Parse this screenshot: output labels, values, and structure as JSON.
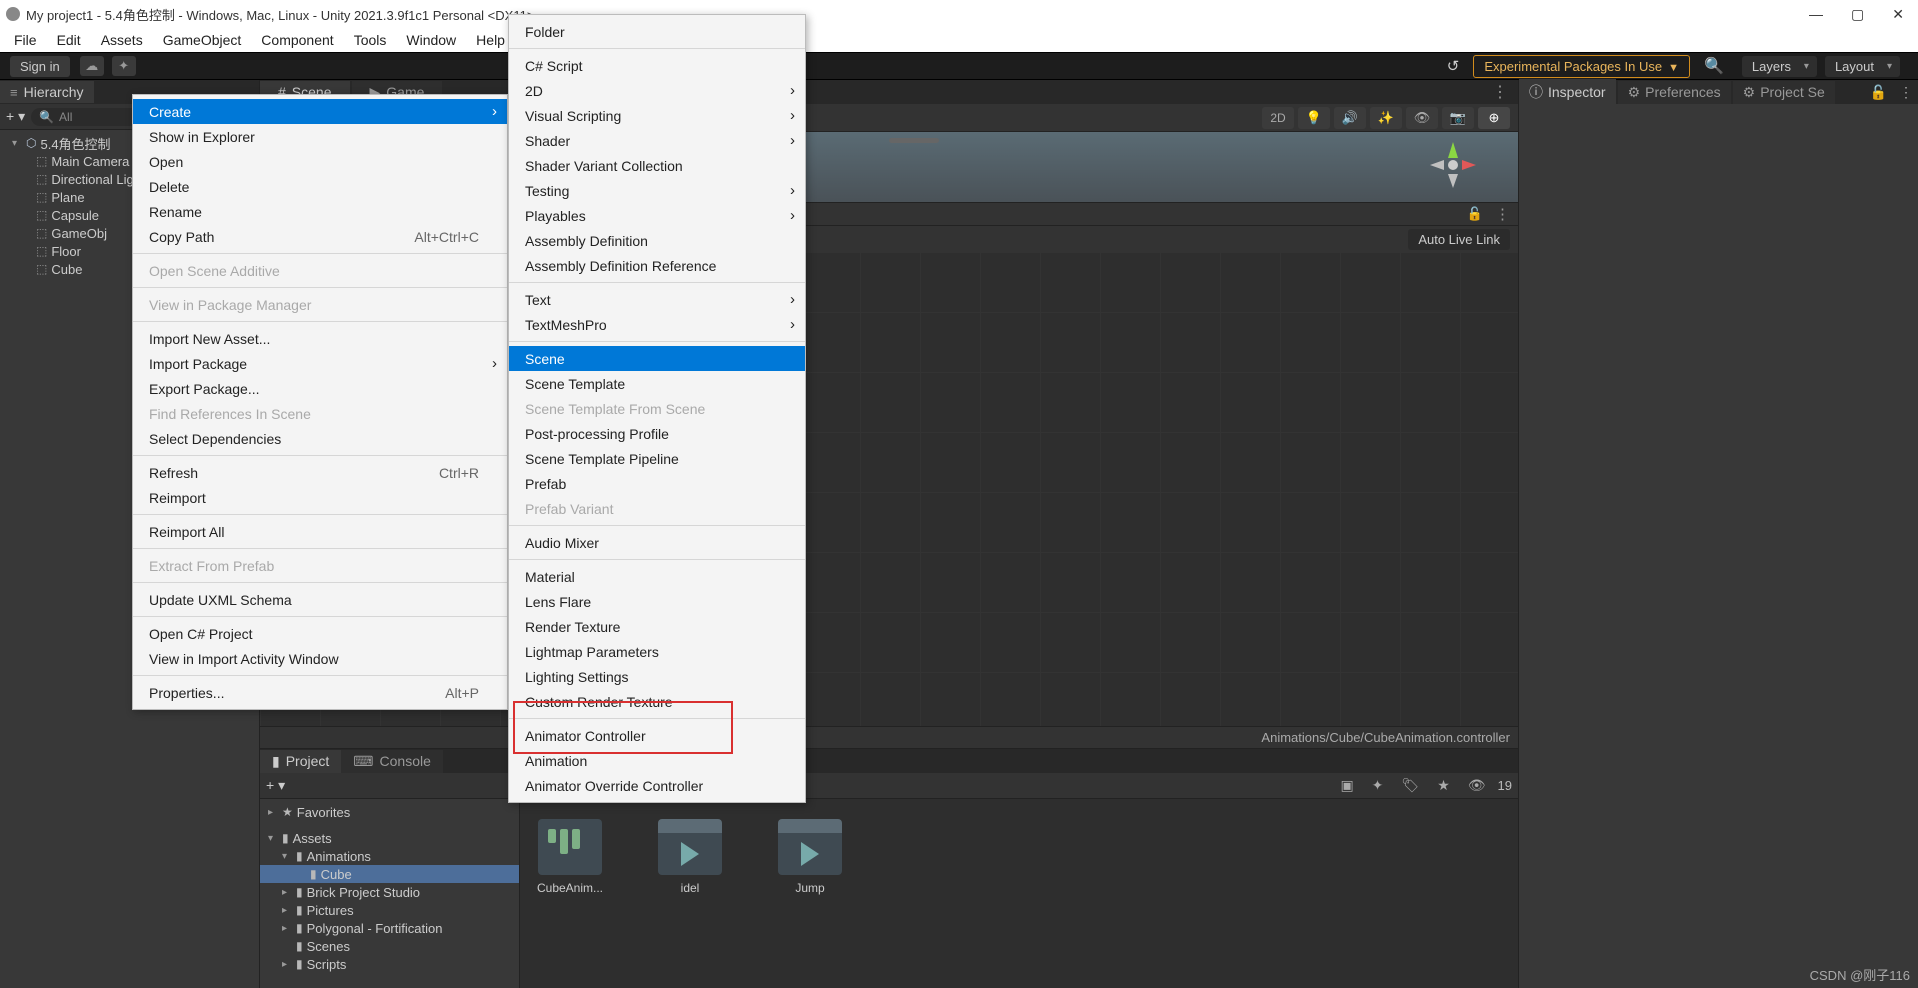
{
  "titlebar": {
    "title": "My project1 - 5.4角色控制 - Windows, Mac, Linux - Unity 2021.3.9f1c1 Personal <DX11>"
  },
  "menubar": [
    "File",
    "Edit",
    "Assets",
    "GameObject",
    "Component",
    "Tools",
    "Window",
    "Help"
  ],
  "toolbar": {
    "signin": "Sign in",
    "experimental": "Experimental Packages In Use",
    "layers": "Layers",
    "layout": "Layout"
  },
  "hierarchy": {
    "tab": "Hierarchy",
    "search_placeholder": "All",
    "scene": "5.4角色控制",
    "items": [
      "Main Camera",
      "Directional Light",
      "Plane",
      "Capsule",
      "GameObj",
      "Floor",
      "Cube"
    ]
  },
  "scene_tabs": {
    "scene": "Scene",
    "game": "Game"
  },
  "scene_toolbar": {
    "d2": "2D"
  },
  "animator": {
    "auto_live": "Auto Live Link",
    "path": "Animations/Cube/CubeAnimation.controller"
  },
  "project": {
    "tab": "Project",
    "console": "Console",
    "hidden_count": "19",
    "favorites": "Favorites",
    "assets": "Assets",
    "folders": [
      "Animations",
      "Cube",
      "Brick Project Studio",
      "Pictures",
      "Polygonal - Fortification",
      "Scenes",
      "Scripts"
    ],
    "assets_grid": [
      "CubeAnim...",
      "idel",
      "Jump"
    ]
  },
  "inspector": {
    "inspector": "Inspector",
    "preferences": "Preferences",
    "project_settings": "Project Se"
  },
  "ctx_assets": {
    "groups": [
      [
        {
          "label": "Create",
          "sub": true,
          "hl": true
        },
        {
          "label": "Show in Explorer"
        },
        {
          "label": "Open"
        },
        {
          "label": "Delete"
        },
        {
          "label": "Rename"
        },
        {
          "label": "Copy Path",
          "shortcut": "Alt+Ctrl+C"
        }
      ],
      [
        {
          "label": "Open Scene Additive",
          "disabled": true
        }
      ],
      [
        {
          "label": "View in Package Manager",
          "disabled": true
        }
      ],
      [
        {
          "label": "Import New Asset..."
        },
        {
          "label": "Import Package",
          "sub": true
        },
        {
          "label": "Export Package..."
        },
        {
          "label": "Find References In Scene",
          "disabled": true
        },
        {
          "label": "Select Dependencies"
        }
      ],
      [
        {
          "label": "Refresh",
          "shortcut": "Ctrl+R"
        },
        {
          "label": "Reimport"
        }
      ],
      [
        {
          "label": "Reimport All"
        }
      ],
      [
        {
          "label": "Extract From Prefab",
          "disabled": true
        }
      ],
      [
        {
          "label": "Update UXML Schema"
        }
      ],
      [
        {
          "label": "Open C# Project"
        },
        {
          "label": "View in Import Activity Window"
        }
      ],
      [
        {
          "label": "Properties...",
          "shortcut": "Alt+P"
        }
      ]
    ]
  },
  "ctx_create": {
    "groups": [
      [
        {
          "label": "Folder"
        }
      ],
      [
        {
          "label": "C# Script"
        },
        {
          "label": "2D",
          "sub": true
        },
        {
          "label": "Visual Scripting",
          "sub": true
        },
        {
          "label": "Shader",
          "sub": true
        },
        {
          "label": "Shader Variant Collection"
        },
        {
          "label": "Testing",
          "sub": true
        },
        {
          "label": "Playables",
          "sub": true
        },
        {
          "label": "Assembly Definition"
        },
        {
          "label": "Assembly Definition Reference"
        }
      ],
      [
        {
          "label": "Text",
          "sub": true
        },
        {
          "label": "TextMeshPro",
          "sub": true
        }
      ],
      [
        {
          "label": "Scene",
          "hl": true
        },
        {
          "label": "Scene Template"
        },
        {
          "label": "Scene Template From Scene",
          "disabled": true
        },
        {
          "label": "Post-processing Profile"
        },
        {
          "label": "Scene Template Pipeline"
        },
        {
          "label": "Prefab"
        },
        {
          "label": "Prefab Variant",
          "disabled": true
        }
      ],
      [
        {
          "label": "Audio Mixer"
        }
      ],
      [
        {
          "label": "Material"
        },
        {
          "label": "Lens Flare"
        },
        {
          "label": "Render Texture"
        },
        {
          "label": "Lightmap Parameters"
        },
        {
          "label": "Lighting Settings"
        },
        {
          "label": "Custom Render Texture"
        }
      ],
      [
        {
          "label": "Animator Controller"
        },
        {
          "label": "Animation"
        },
        {
          "label": "Animator Override Controller"
        }
      ]
    ]
  },
  "watermark": "CSDN @刚子116"
}
